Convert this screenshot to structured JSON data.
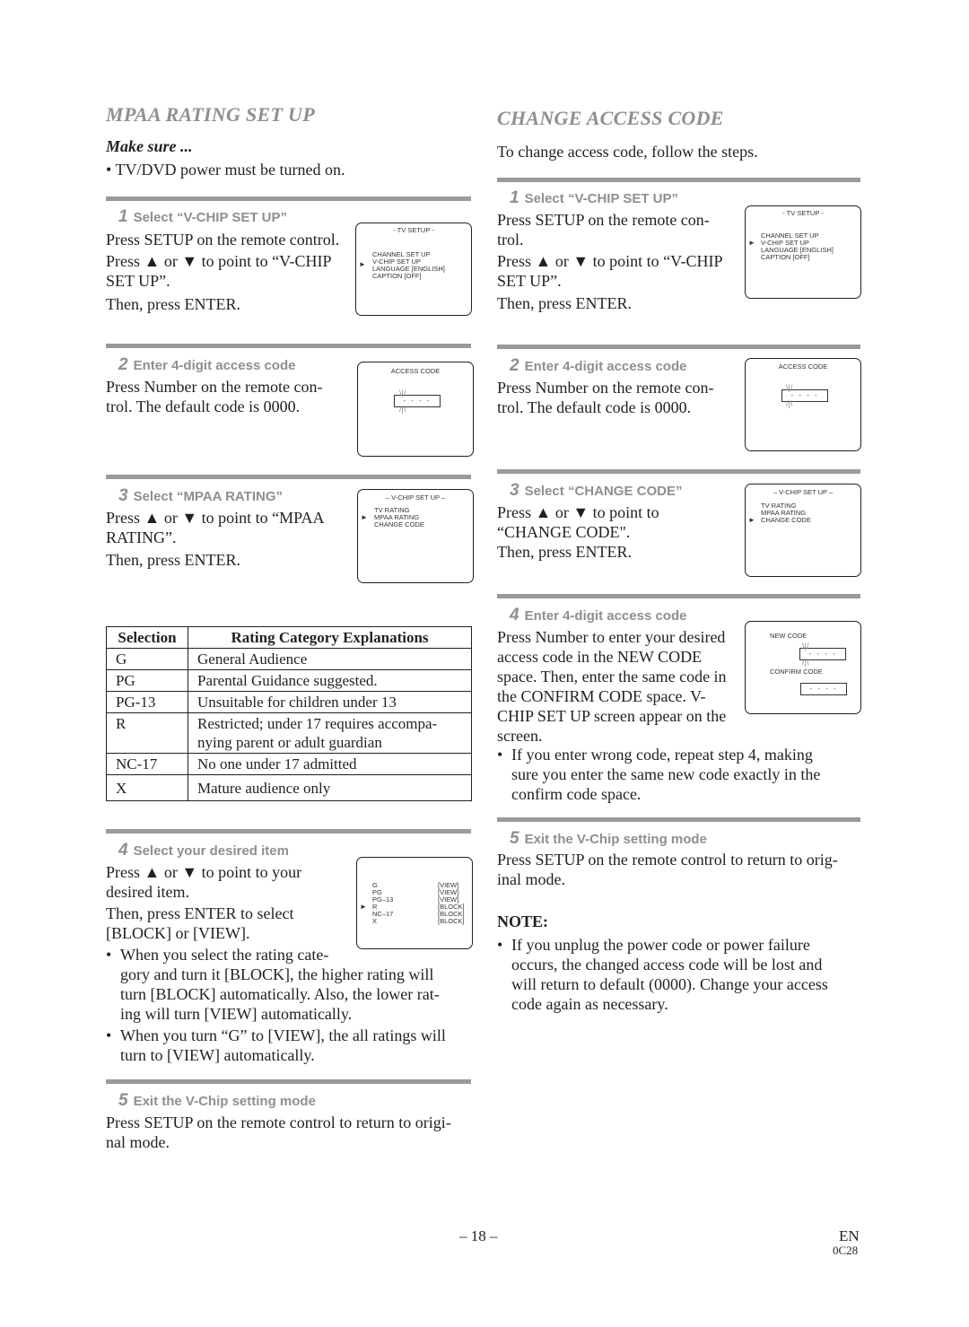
{
  "left": {
    "title": "MPAA RATING SET UP",
    "make_sure": "Make sure ...",
    "make_sure_bullet": "TV/DVD power must be turned on.",
    "steps": [
      {
        "num": "1",
        "heading": "Select “V-CHIP SET UP”",
        "lines": [
          "Press SETUP on the remote control.",
          "Press ▲ or ▼ to point to “V-CHIP",
          "SET UP”.",
          "Then, press ENTER."
        ],
        "screen": {
          "header": "- TV SETUP -",
          "items": [
            "CHANNEL SET UP",
            "V-CHIP SET UP",
            "LANGUAGE  [ENGLISH]",
            "CAPTION  [OFF]"
          ],
          "selected_index": 1
        }
      },
      {
        "num": "2",
        "heading": "Enter 4-digit access code",
        "lines": [
          "Press Number on the remote con-",
          "trol. The default code is 0000."
        ],
        "screen": {
          "header": "ACCESS CODE",
          "code_placeholder": "- - - -"
        }
      },
      {
        "num": "3",
        "heading": "Select “MPAA RATING”",
        "lines": [
          "Press ▲ or ▼ to point to “MPAA",
          "RATING”.",
          "Then, press ENTER."
        ],
        "screen": {
          "header": "– V-CHIP SET UP –",
          "items": [
            "TV RATING",
            "MPAA RATING",
            "CHANGE CODE"
          ],
          "selected_index": 1
        }
      },
      {
        "num": "4",
        "heading": "Select your desired item",
        "lines": [
          "Press ▲ or ▼ to point to your",
          "desired item.",
          "Then, press ENTER to select",
          "[BLOCK] or [VIEW]."
        ],
        "screen": {
          "ratings": [
            {
              "label": "G",
              "state": "[VIEW]"
            },
            {
              "label": "PG",
              "state": "[VIEW]"
            },
            {
              "label": "PG–13",
              "state": "[VIEW]"
            },
            {
              "label": "R",
              "state": "[BLOCK]"
            },
            {
              "label": "NC–17",
              "state": "[BLOCK]"
            },
            {
              "label": "X",
              "state": "[BLOCK]"
            }
          ],
          "selected_index": 3
        },
        "bullets": [
          [
            "When you select the rating cate-",
            "gory and turn it [BLOCK], the higher rating will",
            "turn [BLOCK] automatically.  Also, the lower rat-",
            "ing will turn [VIEW] automatically."
          ],
          [
            "When you turn “G” to [VIEW], the all ratings will",
            "turn to [VIEW] automatically."
          ]
        ]
      },
      {
        "num": "5",
        "heading": "Exit the V-Chip setting mode",
        "lines": [
          "Press SETUP on the remote control to return to origi-",
          "nal mode."
        ]
      }
    ],
    "table": {
      "headers": [
        "Selection",
        "Rating Category Explanations"
      ],
      "rows": [
        [
          "G",
          "General Audience"
        ],
        [
          "PG",
          "Parental Guidance suggested."
        ],
        [
          "PG-13",
          "Unsuitable for children under 13"
        ],
        [
          "R",
          "Restricted; under 17 requires accompa-\nnying parent or adult guardian"
        ],
        [
          "NC-17",
          "No one under 17 admitted"
        ],
        [
          "X",
          "Mature audience only"
        ]
      ]
    }
  },
  "right": {
    "title": "CHANGE ACCESS CODE",
    "intro": "To change access code, follow the steps.",
    "steps": [
      {
        "num": "1",
        "heading": "Select “V-CHIP SET UP”",
        "lines": [
          "Press SETUP on the remote con-",
          "trol.",
          "Press ▲ or ▼ to point to “V-CHIP",
          "SET UP”.",
          "Then, press ENTER."
        ],
        "screen": {
          "header": "- TV SETUP -",
          "items": [
            "CHANNEL SET UP",
            "V-CHIP SET UP",
            "LANGUAGE  [ENGLISH]",
            "CAPTION  [OFF]"
          ],
          "selected_index": 1
        }
      },
      {
        "num": "2",
        "heading": "Enter 4-digit access code",
        "lines": [
          "Press Number on the remote con-",
          "trol. The default code is 0000."
        ],
        "screen": {
          "header": "ACCESS CODE",
          "code_placeholder": "- - - -"
        }
      },
      {
        "num": "3",
        "heading": "Select “CHANGE CODE”",
        "lines": [
          "Press ▲ or ▼ to point to",
          "“CHANGE CODE\".",
          "Then, press ENTER."
        ],
        "screen": {
          "header": "– V-CHIP SET UP –",
          "items": [
            "TV RATING",
            "MPAA RATING",
            "CHANGE CODE"
          ],
          "selected_index": 2
        }
      },
      {
        "num": "4",
        "heading": "Enter 4-digit access code",
        "lines": [
          "Press Number to enter your desired",
          "access code in the NEW CODE",
          "space. Then, enter the same code in",
          "the CONFIRM CODE space. V-",
          "CHIP SET UP screen appear on the",
          "screen."
        ],
        "screen": {
          "new_code_label": "NEW CODE",
          "confirm_code_label": "CONFIRM CODE",
          "code_placeholder": "- - - -"
        },
        "bullets": [
          [
            "If you enter wrong code, repeat step 4, making",
            "sure you enter the same new code exactly in the",
            "confirm code space."
          ]
        ]
      },
      {
        "num": "5",
        "heading": "Exit the V-Chip setting mode",
        "lines": [
          "Press SETUP on the remote control to return to orig-",
          "inal mode."
        ]
      }
    ],
    "note_heading": "NOTE:",
    "note_lines": [
      "If you unplug the power code or power failure",
      "occurs, the changed access code will be lost and",
      "will return to default (0000). Change your access",
      "code again as necessary."
    ]
  },
  "footer": {
    "page_number": "– 18 –",
    "lang": "EN",
    "code": "0C28"
  },
  "glyphs": {
    "bullet": "•",
    "pointer": "►"
  }
}
